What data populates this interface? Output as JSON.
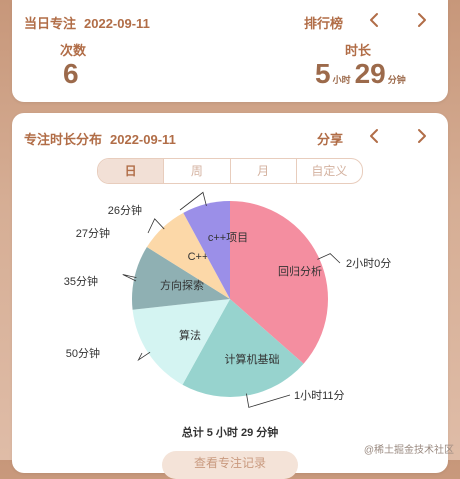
{
  "today": {
    "title": "当日专注",
    "date": "2022-09-11",
    "ranking_label": "排行榜",
    "count_label": "次数",
    "count_value": "6",
    "duration_label": "时长",
    "duration_hours": "5",
    "duration_hours_unit": "小时",
    "duration_minutes": "29",
    "duration_minutes_unit": "分钟"
  },
  "distribution": {
    "title": "专注时长分布",
    "date": "2022-09-11",
    "share_label": "分享",
    "tabs": [
      "日",
      "周",
      "月",
      "自定义"
    ],
    "active_tab": "日",
    "total_text": "总计 5 小时 29 分钟",
    "add_button_label": "查看专注记录"
  },
  "chart_data": {
    "type": "pie",
    "slices": [
      {
        "name": "回归分析",
        "label": "2小时0分",
        "minutes": 120,
        "color": "#f48ea0"
      },
      {
        "name": "计算机基础",
        "label": "1小时11分",
        "minutes": 71,
        "color": "#97d3ce"
      },
      {
        "name": "算法",
        "label": "50分钟",
        "minutes": 50,
        "color": "#d4f4f2"
      },
      {
        "name": "方向探索",
        "label": "35分钟",
        "minutes": 35,
        "color": "#8fb0b3"
      },
      {
        "name": "C++",
        "label": "27分钟",
        "minutes": 27,
        "color": "#fcd8a8"
      },
      {
        "name": "c++项目",
        "label": "26分钟",
        "minutes": 26,
        "color": "#9b8fe8"
      }
    ]
  },
  "icons": {
    "prev": "chevron-left-icon",
    "next": "chevron-right-icon"
  },
  "watermark": "@稀土掘金技术社区"
}
